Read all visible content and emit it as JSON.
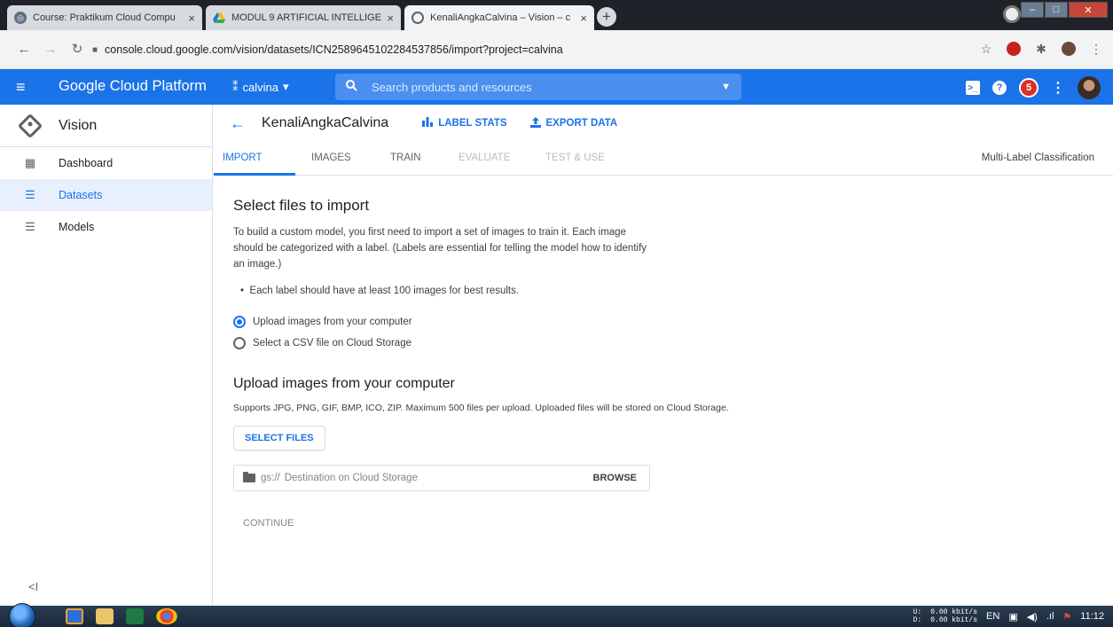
{
  "browser": {
    "tabs": [
      {
        "title": "Course: Praktikum Cloud Compu",
        "close": "×"
      },
      {
        "title": "MODUL 9 ARTIFICIAL INTELLIGE",
        "close": "×"
      },
      {
        "title": "KenaliAngkaCalvina – Vision – c",
        "close": "×"
      }
    ],
    "new_tab": "+",
    "url": "console.cloud.google.com/vision/datasets/ICN2589645102284537856/import?project=calvina"
  },
  "header": {
    "brand": "Google Cloud Platform",
    "project": "calvina",
    "search_placeholder": "Search products and resources",
    "notification_count": "5"
  },
  "sidebar": {
    "product": "Vision",
    "items": [
      {
        "label": "Dashboard"
      },
      {
        "label": "Datasets"
      },
      {
        "label": "Models"
      }
    ],
    "collapse": "<I"
  },
  "dataset": {
    "title": "KenaliAngkaCalvina",
    "label_stats": "LABEL STATS",
    "export_data": "EXPORT DATA"
  },
  "tabs": {
    "import": "IMPORT",
    "images": "IMAGES",
    "train": "TRAIN",
    "evaluate": "EVALUATE",
    "test_use": "TEST & USE",
    "mode": "Multi-Label Classification"
  },
  "import": {
    "heading": "Select files to import",
    "intro": "To build a custom model, you first need to import a set of images to train it. Each image should be categorized with a label. (Labels are essential for telling the model how to identify an image.)",
    "bullet": "Each label should have at least 100 images for best results.",
    "option_upload": "Upload images from your computer",
    "option_csv": "Select a CSV file on Cloud Storage",
    "upload_heading": "Upload images from your computer",
    "supports": "Supports JPG, PNG, GIF, BMP, ICO, ZIP. Maximum 500 files per upload. Uploaded files will be stored on Cloud Storage.",
    "select_files": "SELECT FILES",
    "gs_prefix": "gs://",
    "destination_placeholder": "Destination on Cloud Storage",
    "browse": "BROWSE",
    "continue": "CONTINUE"
  },
  "taskbar": {
    "speed_up_label": "U:",
    "speed_down_label": "D:",
    "speed_up": "0.00 kbit/s",
    "speed_down": "0.00 kbit/s",
    "lang": "EN",
    "time": "11:12"
  }
}
